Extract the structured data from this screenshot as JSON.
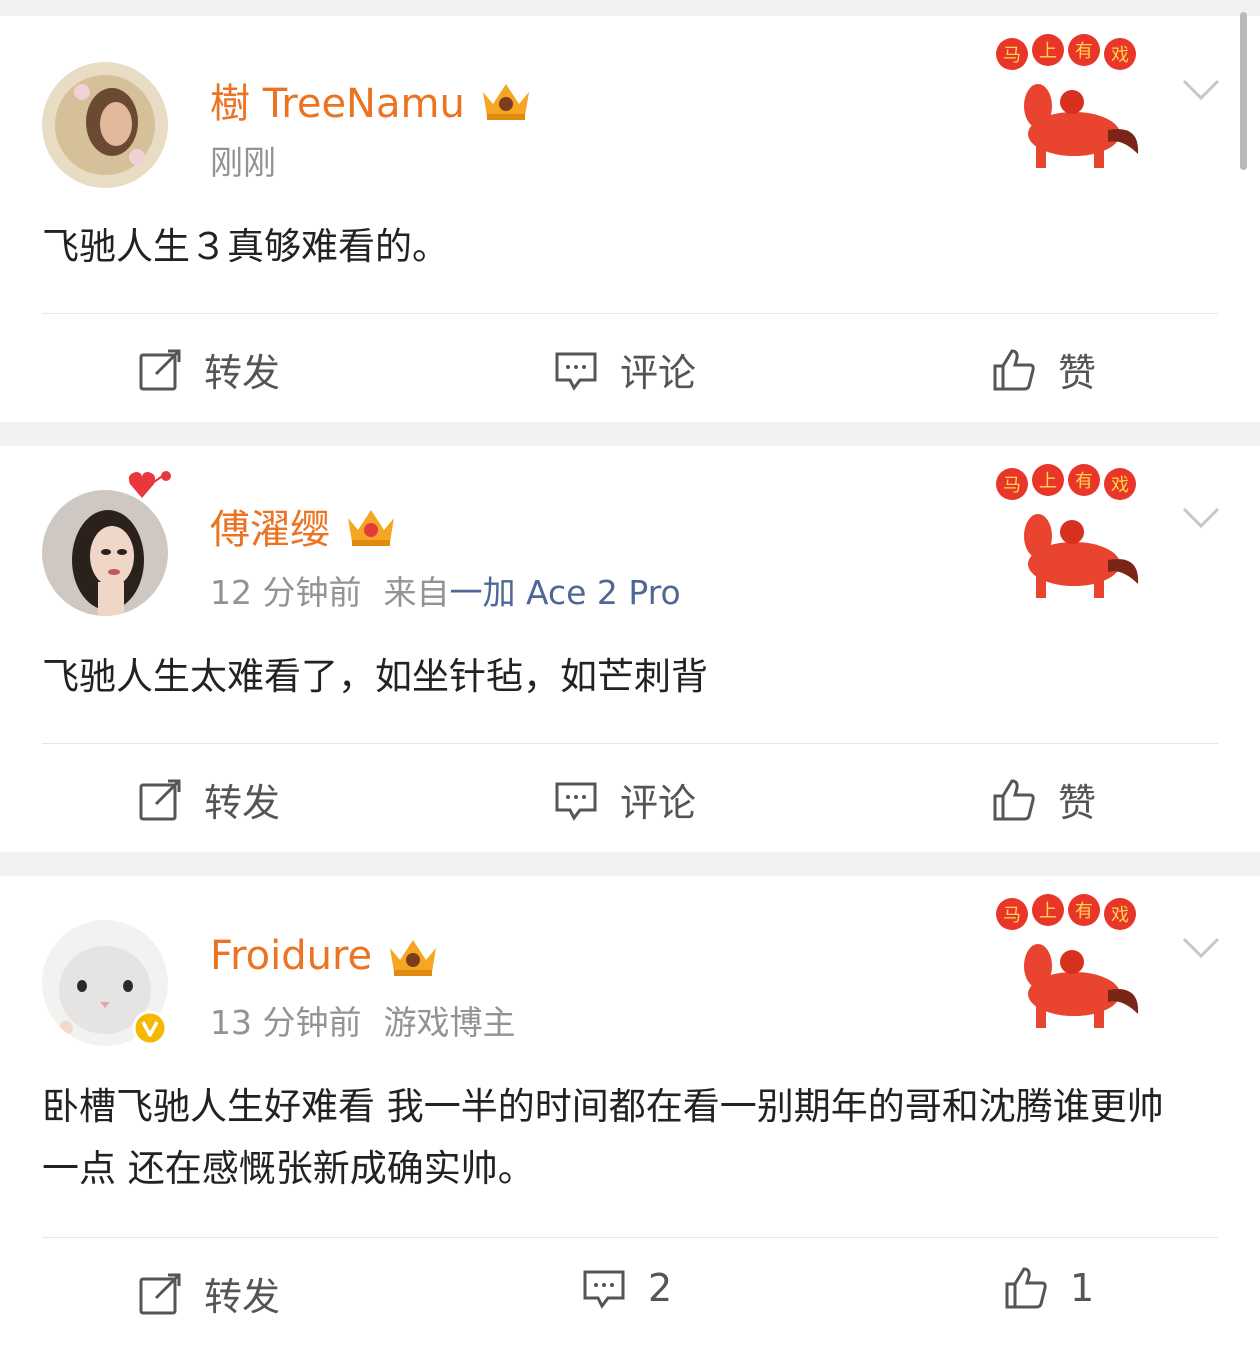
{
  "posts": [
    {
      "username": "樹 TreeNamu",
      "time": "刚刚",
      "source_prefix": "",
      "source_device": "",
      "text": "飞驰人生３真够难看的。",
      "actions": {
        "repost": "转发",
        "comment": "评论",
        "like": "赞"
      }
    },
    {
      "username": "傅濯缨",
      "time": "12 分钟前",
      "source_prefix": "来自",
      "source_device": "一加 Ace 2 Pro",
      "text": "飞驰人生太难看了，如坐针毡，如芒刺背",
      "actions": {
        "repost": "转发",
        "comment": "评论",
        "like": "赞"
      }
    },
    {
      "username": "Froidure",
      "time": "13 分钟前",
      "source_prefix": "游戏博主",
      "source_device": "",
      "text": "卧槽飞驰人生好难看 我一半的时间都在看一别期年的哥和沈腾谁更帅一点 还在感慨张新成确实帅。",
      "actions": {
        "repost": "转发",
        "comment": "2",
        "like": "1"
      }
    }
  ],
  "sticker_text": "马上有戏",
  "colors": {
    "username": "#eb7322",
    "meta": "#939393",
    "device": "#4f6795",
    "text": "#222222",
    "verified": "#f5b800"
  },
  "icons": [
    "repost-icon",
    "comment-icon",
    "like-icon",
    "chevron-down-icon",
    "crown-badge-icon",
    "verified-badge-icon"
  ]
}
